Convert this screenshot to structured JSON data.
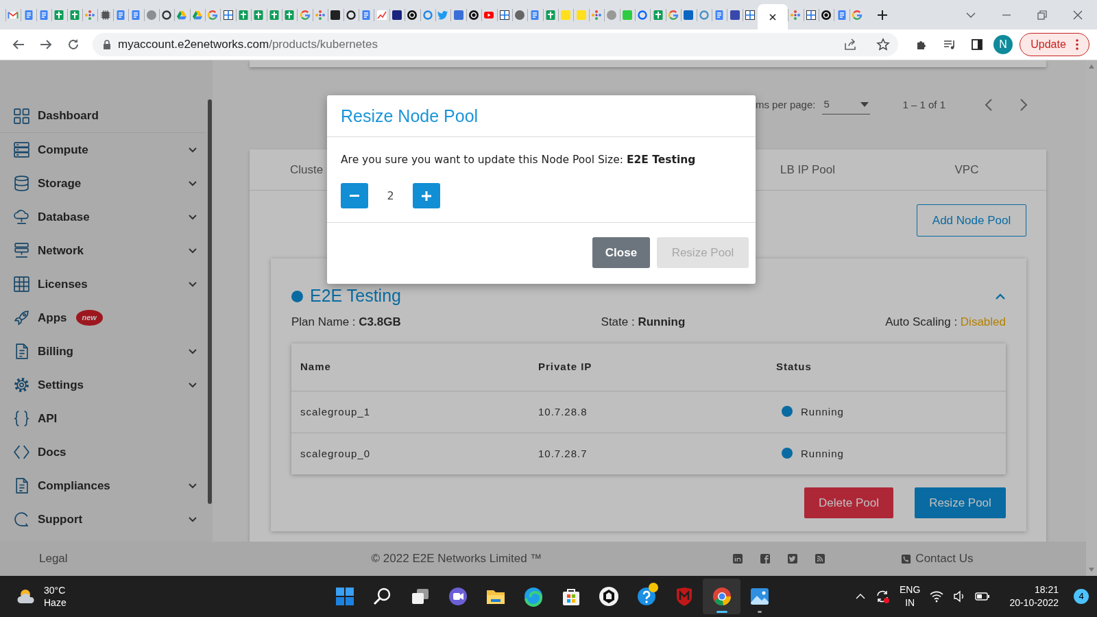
{
  "browser": {
    "tabs": [
      {
        "kind": "mail",
        "selected": false
      },
      {
        "kind": "doc",
        "selected": false
      },
      {
        "kind": "doc",
        "selected": false
      },
      {
        "kind": "sheet",
        "selected": false
      },
      {
        "kind": "sheet",
        "selected": false
      },
      {
        "kind": "pinwheel",
        "selected": false
      },
      {
        "kind": "chip",
        "selected": false
      },
      {
        "kind": "doc",
        "selected": false
      },
      {
        "kind": "doc",
        "selected": false
      },
      {
        "kind": "circle",
        "color": "#8a8f96",
        "selected": false
      },
      {
        "kind": "ring",
        "color": "#333333",
        "selected": false
      },
      {
        "kind": "drive",
        "selected": false
      },
      {
        "kind": "drive",
        "selected": false
      },
      {
        "kind": "glogo",
        "selected": false
      },
      {
        "kind": "diagram",
        "selected": false
      },
      {
        "kind": "sheet",
        "selected": false
      },
      {
        "kind": "sheet",
        "selected": false
      },
      {
        "kind": "sheet",
        "selected": false
      },
      {
        "kind": "sheet",
        "selected": false
      },
      {
        "kind": "glogo",
        "selected": false
      },
      {
        "kind": "pinwheel",
        "selected": false
      },
      {
        "kind": "square",
        "color": "#222222",
        "selected": false
      },
      {
        "kind": "ring",
        "color": "#222222",
        "selected": false
      },
      {
        "kind": "doc",
        "selected": false
      },
      {
        "kind": "chart",
        "selected": false
      },
      {
        "kind": "square",
        "color": "#1a237e",
        "selected": false
      },
      {
        "kind": "disc",
        "selected": false
      },
      {
        "kind": "ring",
        "color": "#1e88e5",
        "selected": false
      },
      {
        "kind": "bird",
        "selected": false
      },
      {
        "kind": "square",
        "color": "#3b6fd8",
        "selected": false
      },
      {
        "kind": "disc",
        "selected": false
      },
      {
        "kind": "play",
        "selected": false
      },
      {
        "kind": "diagram",
        "selected": false
      },
      {
        "kind": "circle",
        "color": "#666666",
        "selected": false
      },
      {
        "kind": "doc",
        "selected": false
      },
      {
        "kind": "sheet",
        "selected": false
      },
      {
        "kind": "square",
        "color": "#ffe01b",
        "selected": false
      },
      {
        "kind": "square",
        "color": "#ffe01b",
        "selected": false
      },
      {
        "kind": "pinwheel",
        "selected": false
      },
      {
        "kind": "circle",
        "color": "#999999",
        "selected": false
      },
      {
        "kind": "square",
        "color": "#2ecc40",
        "selected": false
      },
      {
        "kind": "ring",
        "color": "#0866ff",
        "selected": false
      },
      {
        "kind": "sheet",
        "selected": false
      },
      {
        "kind": "glogo",
        "selected": false
      },
      {
        "kind": "square",
        "color": "#0a66c2",
        "selected": false
      },
      {
        "kind": "ring",
        "color": "#4a90c2",
        "selected": false
      },
      {
        "kind": "doc",
        "selected": false
      },
      {
        "kind": "square",
        "color": "#3949ab",
        "selected": false
      },
      {
        "kind": "diagram",
        "selected": false
      },
      {
        "selected": true
      },
      {
        "kind": "pinwheel",
        "selected": false
      },
      {
        "kind": "diagram",
        "selected": false
      },
      {
        "kind": "disc",
        "selected": false
      },
      {
        "kind": "doc",
        "selected": false
      },
      {
        "kind": "glogo",
        "selected": false
      }
    ],
    "url_host": "myaccount.e2enetworks.com",
    "url_path": "/products/kubernetes",
    "profile_initial": "N",
    "update_label": "Update"
  },
  "sidebar": {
    "items": [
      {
        "label": "Dashboard",
        "kind": "dashboard",
        "expandable": false
      },
      {
        "label": "Compute",
        "kind": "server",
        "expandable": true
      },
      {
        "label": "Storage",
        "kind": "database",
        "expandable": true
      },
      {
        "label": "Database",
        "kind": "cloud",
        "expandable": true
      },
      {
        "label": "Network",
        "kind": "network",
        "expandable": true
      },
      {
        "label": "Licenses",
        "kind": "grid",
        "expandable": true
      },
      {
        "label": "Apps",
        "kind": "rocket",
        "expandable": false,
        "badge": "new"
      },
      {
        "label": "Billing",
        "kind": "invoice",
        "expandable": true
      },
      {
        "label": "Settings",
        "kind": "gear",
        "expandable": true
      },
      {
        "label": "API",
        "kind": "braces",
        "expandable": false
      },
      {
        "label": "Docs",
        "kind": "code",
        "expandable": false
      },
      {
        "label": "Compliances",
        "kind": "invoice",
        "expandable": true
      },
      {
        "label": "Support",
        "kind": "bubble",
        "expandable": true
      }
    ]
  },
  "pagination": {
    "items_per_page_label": "ms per page:",
    "page_size": "5",
    "range": "1 – 1 of 1"
  },
  "cluster_tabs": [
    {
      "label": "Cluste"
    },
    {
      "label": "LB IP Pool"
    },
    {
      "label": "VPC"
    }
  ],
  "add_button": "Add Node Pool",
  "node_pool": {
    "name": "E2E Testing",
    "expanded": true,
    "info": [
      {
        "label": "Plan Name : ",
        "value": "C3.8GB",
        "kind": "plain"
      },
      {
        "label": "State : ",
        "value": "Running",
        "kind": "plain"
      },
      {
        "label": "Auto Scaling : ",
        "value": "Disabled",
        "kind": "warning"
      }
    ],
    "table": {
      "columns": [
        "Name",
        "Private IP",
        "Status"
      ],
      "rows": [
        {
          "name": "scalegroup_1",
          "ip": "10.7.28.8",
          "status": "Running"
        },
        {
          "name": "scalegroup_0",
          "ip": "10.7.28.7",
          "status": "Running"
        }
      ]
    },
    "buttons": [
      {
        "label": "Delete Pool",
        "kind": "danger"
      },
      {
        "label": "Resize Pool",
        "kind": "primary"
      }
    ]
  },
  "footer": {
    "legal": "Legal",
    "copyright": "© 2022 E2E Networks Limited ™",
    "social": [
      {
        "kind": "linkedin"
      },
      {
        "kind": "facebook"
      },
      {
        "kind": "twitter"
      },
      {
        "kind": "rss"
      }
    ],
    "contact": "Contact Us"
  },
  "modal": {
    "title": "Resize Node Pool",
    "message": "Are you sure you want to update this Node Pool Size: **E2E Testing**",
    "value": "2",
    "buttons": [
      {
        "label": "Close",
        "disabled": false
      },
      {
        "label": "Resize Pool",
        "disabled": true
      }
    ]
  },
  "taskbar": {
    "weather": {
      "temp": "30°C",
      "condition": "Haze"
    },
    "apps": [
      {
        "kind": "start",
        "running": false,
        "focused": false
      },
      {
        "kind": "search",
        "running": false,
        "focused": false
      },
      {
        "kind": "taskview",
        "running": false,
        "focused": false
      },
      {
        "kind": "chat",
        "running": false,
        "focused": false
      },
      {
        "kind": "folder",
        "running": false,
        "focused": false
      },
      {
        "kind": "swirl",
        "running": false,
        "focused": false
      },
      {
        "kind": "bag",
        "running": false,
        "focused": false
      },
      {
        "kind": "blackcircle",
        "running": false,
        "focused": false
      },
      {
        "kind": "help",
        "running": false,
        "focused": false
      },
      {
        "kind": "shield",
        "running": false,
        "focused": false
      },
      {
        "kind": "browser",
        "running": true,
        "focused": true
      },
      {
        "kind": "photo",
        "running": true,
        "focused": false
      }
    ],
    "tray": {
      "lang": "ENG",
      "region": "IN",
      "time": "18:21",
      "date": "20-10-2022",
      "notifications": "4"
    }
  }
}
